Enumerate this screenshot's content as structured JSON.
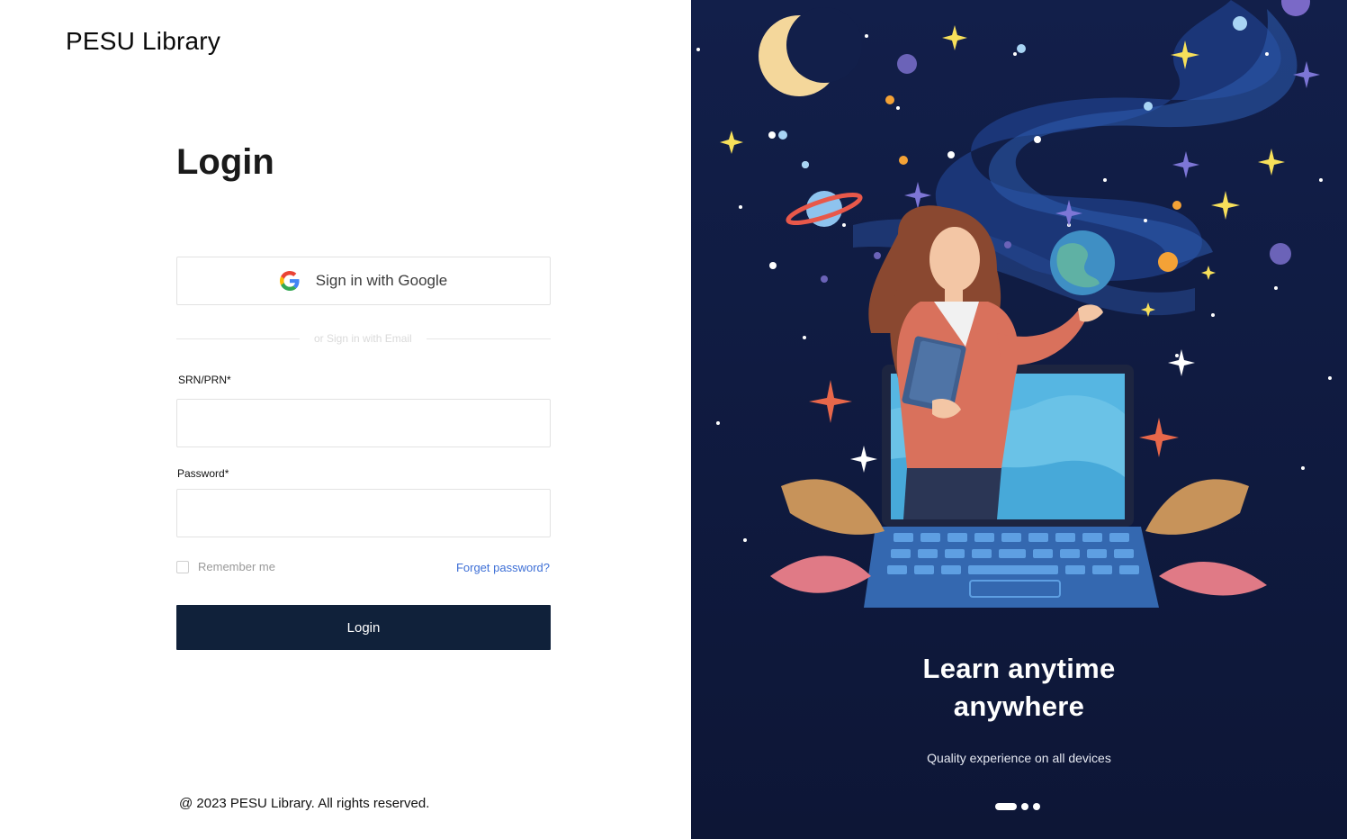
{
  "brand": {
    "name": "PESU Library"
  },
  "login": {
    "title": "Login",
    "google_button_label": "Sign in with Google",
    "divider_text": "or Sign in with Email",
    "srn_label": "SRN/PRN*",
    "srn_value": "",
    "password_label": "Password*",
    "password_value": "",
    "remember_label": "Remember me",
    "remember_checked": false,
    "forgot_label": "Forget password?",
    "submit_label": "Login"
  },
  "footer": {
    "text": "@ 2023 PESU Library. All rights reserved."
  },
  "hero": {
    "title_line1": "Learn anytime",
    "title_line2": "anywhere",
    "subtitle": "Quality experience on all devices",
    "slide_count": 3,
    "active_slide": 1,
    "background_color": "#0f1a3d"
  },
  "colors": {
    "primary_button": "#10213a",
    "link": "#3d6fd6"
  },
  "icons": {
    "google": "google-g-icon"
  }
}
